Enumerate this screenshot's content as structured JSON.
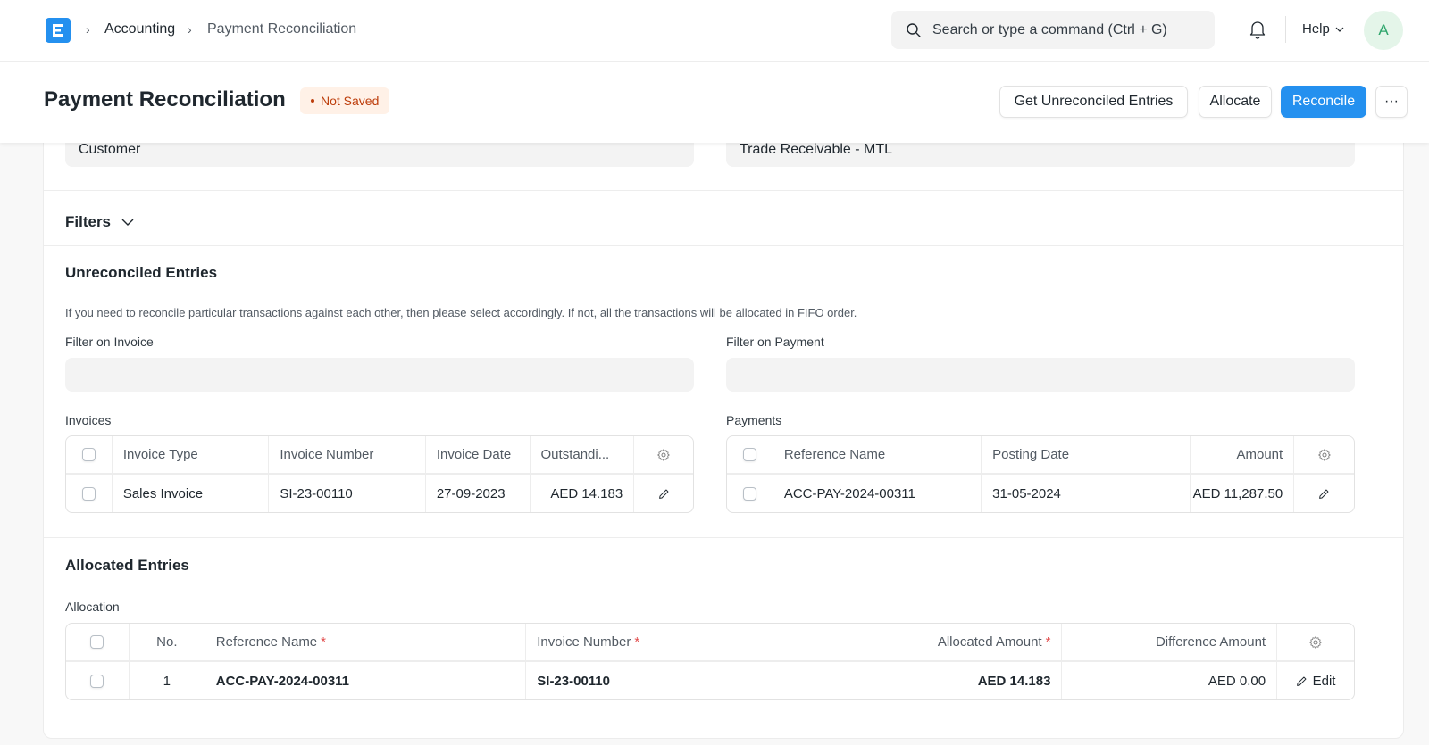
{
  "navbar": {
    "logo_letter": "E",
    "breadcrumbs": [
      "Accounting",
      "Payment Reconciliation"
    ],
    "search_placeholder": "Search or type a command (Ctrl + G)",
    "help_label": "Help",
    "avatar_initial": "A"
  },
  "page": {
    "title": "Payment Reconciliation",
    "status_badge": "Not Saved",
    "actions": {
      "get_entries": "Get Unreconciled Entries",
      "allocate": "Allocate",
      "reconcile": "Reconcile",
      "more": "···"
    }
  },
  "fields": {
    "party_type": "Customer",
    "receivable_account": "Trade Receivable - MTL"
  },
  "filters": {
    "label": "Filters"
  },
  "unreconciled": {
    "title": "Unreconciled Entries",
    "help_text": "If you need to reconcile particular transactions against each other, then please select accordingly. If not, all the transactions will be allocated in FIFO order.",
    "filter_invoice_label": "Filter on Invoice",
    "filter_invoice_value": "",
    "filter_payment_label": "Filter on Payment",
    "filter_payment_value": "",
    "invoices": {
      "label": "Invoices",
      "columns": [
        "Invoice Type",
        "Invoice Number",
        "Invoice Date",
        "Outstandi..."
      ],
      "rows": [
        {
          "invoice_type": "Sales Invoice",
          "invoice_number": "SI-23-00110",
          "invoice_date": "27-09-2023",
          "outstanding": "AED 14.183"
        }
      ]
    },
    "payments": {
      "label": "Payments",
      "columns": [
        "Reference Name",
        "Posting Date",
        "Amount"
      ],
      "rows": [
        {
          "reference_name": "ACC-PAY-2024-00311",
          "posting_date": "31-05-2024",
          "amount": "AED 11,287.50"
        }
      ]
    }
  },
  "allocated": {
    "title": "Allocated Entries",
    "table_label": "Allocation",
    "columns": [
      "No.",
      "Reference Name",
      "Invoice Number",
      "Allocated Amount",
      "Difference Amount"
    ],
    "required_marker": "*",
    "rows": [
      {
        "no": "1",
        "reference_name": "ACC-PAY-2024-00311",
        "invoice_number": "SI-23-00110",
        "allocated_amount": "AED 14.183",
        "difference_amount": "AED 0.00",
        "edit_label": "Edit"
      }
    ]
  },
  "colors": {
    "primary": "#2490ef",
    "badge_bg": "#fff1e7",
    "badge_text": "#bd3e0c",
    "avatar_bg": "#e4f5e9",
    "avatar_text": "#30a66d",
    "required": "#e24c4c"
  }
}
